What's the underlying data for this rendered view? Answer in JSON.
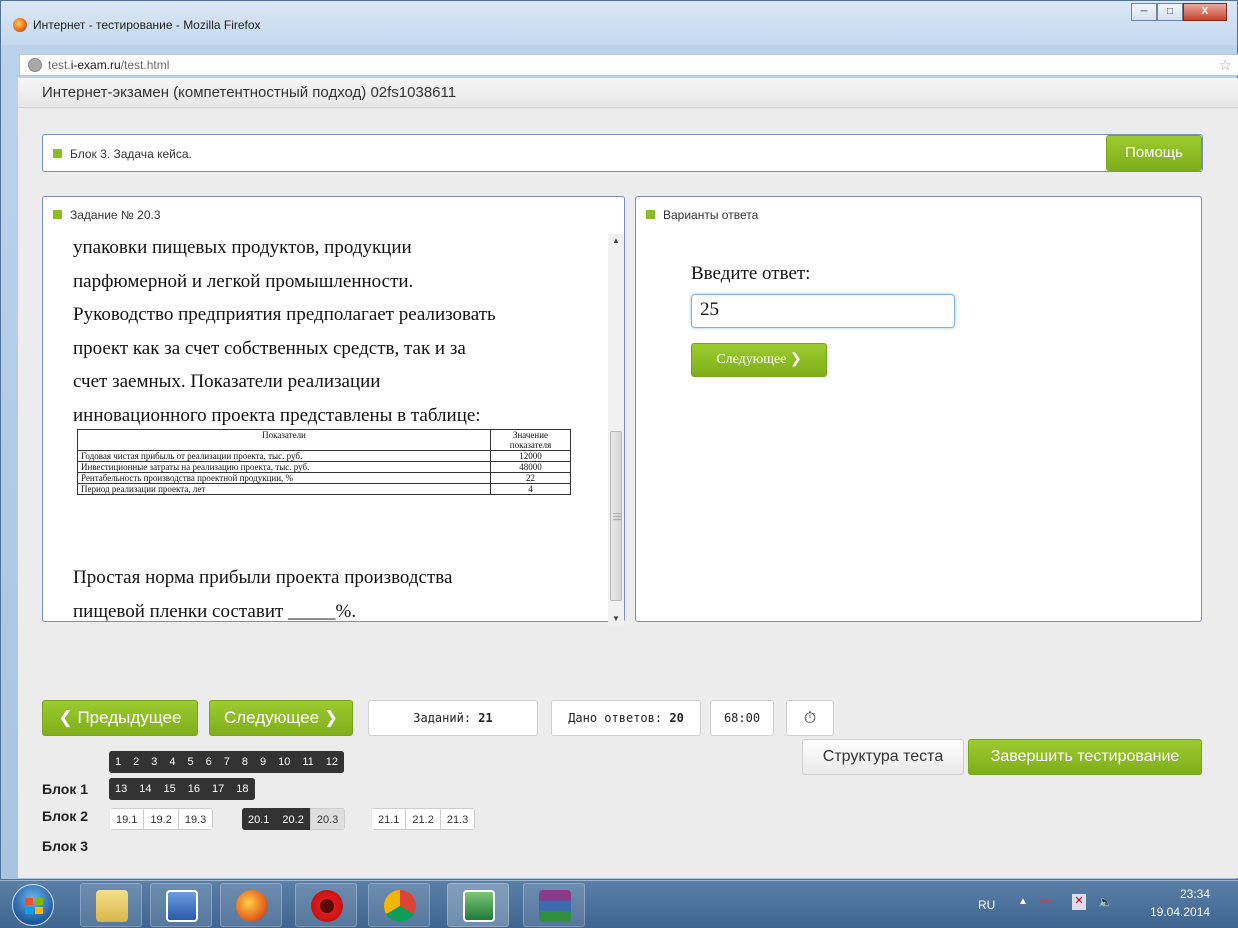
{
  "window": {
    "title": "Интернет - тестирование - Mozilla Firefox",
    "controls": {
      "minimize": "─",
      "maximize": "□",
      "close": "X"
    }
  },
  "browser": {
    "url_prefix": "test.",
    "url_domain": "i-exam.ru",
    "url_path": "/test.html",
    "star": "☆"
  },
  "page": {
    "title": "Интернет-экзамен (компетентностный подход) 02fs1038611",
    "block_bar": {
      "label": "Блок 3. Задача кейса.",
      "help_button": "Помощь"
    },
    "task": {
      "label": "Задание № 20.3",
      "text_lines": [
        "упаковки пищевых продуктов, продукции",
        "парфюмерной и легкой промышленности.",
        "Руководство предприятия предполагает реализовать",
        "проект как за счет собственных средств, так и за",
        "счет заемных. Показатели реализации",
        "инновационного проекта представлены в таблице:"
      ],
      "table": {
        "headers": [
          "Показатели",
          "Значение показателя"
        ],
        "rows": [
          [
            "Годовая чистая прибыль от реализации проекта, тыс. руб.",
            "12000"
          ],
          [
            "Инвестиционные затраты на реализацию проекта, тыс. руб.",
            "48000"
          ],
          [
            "Рентабельность производства проектной продукции, %",
            "22"
          ],
          [
            "Период реализации проекта, лет",
            "4"
          ]
        ]
      },
      "question_lines": [
        "Простая норма прибыли проекта производства",
        "пищевой пленки составит _____%."
      ]
    },
    "answer": {
      "label": "Варианты ответа",
      "prompt": "Введите ответ:",
      "value": "25",
      "next_button": "Следующее ❯"
    },
    "nav": {
      "prev_button": "❮ Предыдущее",
      "next_button": "Следующее ❯",
      "tasks_label": "Заданий:",
      "tasks_count": "21",
      "answers_label": "Дано ответов:",
      "answers_count": "20",
      "timer": "68:00",
      "clock_icon": "⏱",
      "structure_button": "Структура теста",
      "finish_button": "Завершить тестирование"
    },
    "blocks": {
      "labels": [
        "Блок 1",
        "Блок 2",
        "Блок 3"
      ],
      "block1_row1": [
        "1",
        "2",
        "3",
        "4",
        "5",
        "6",
        "7",
        "8",
        "9",
        "10",
        "11",
        "12"
      ],
      "block1_row2": [
        "13",
        "14",
        "15",
        "16",
        "17",
        "18"
      ],
      "block3_group1": [
        "19.1",
        "19.2",
        "19.3"
      ],
      "block3_group2": [
        "20.1",
        "20.2",
        "20.3"
      ],
      "block3_group3": [
        "21.1",
        "21.2",
        "21.3"
      ]
    }
  },
  "taskbar": {
    "lang": "RU",
    "time": "23:34",
    "date": "19.04.2014"
  }
}
